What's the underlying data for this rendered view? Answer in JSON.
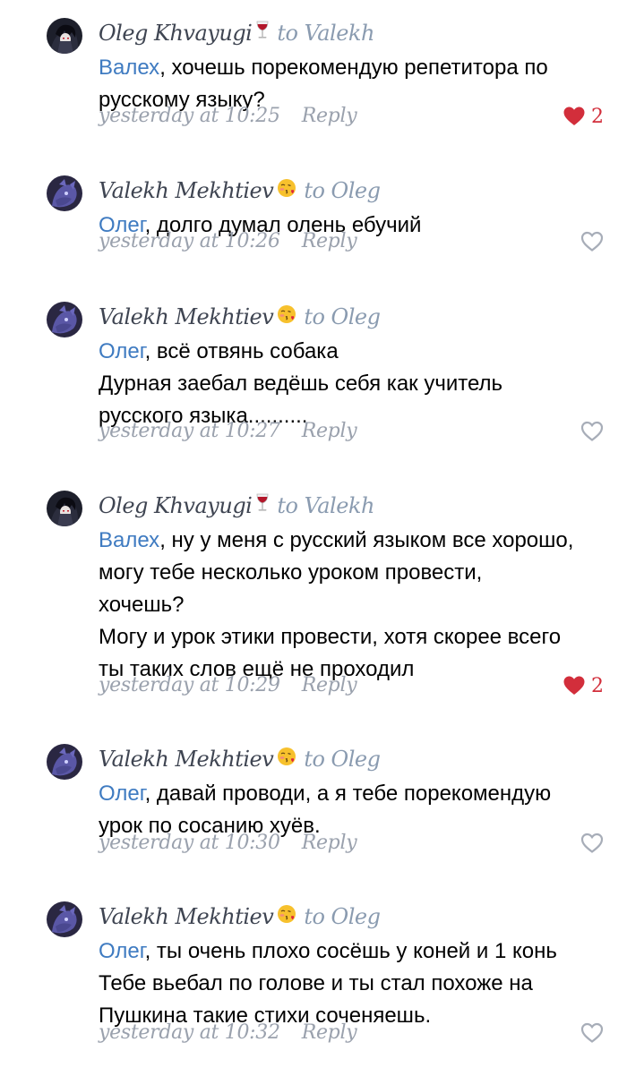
{
  "comments": [
    {
      "author": "Oleg Khvayugi",
      "author_emoji": "wine-glass-icon",
      "to": "to Valekh",
      "mention": "Валех",
      "lines": [
        ", хочешь порекомендую репетитора по",
        "русскому языку?"
      ],
      "time": "yesterday at 10:25",
      "reply": "Reply",
      "liked": true,
      "likes": "2"
    },
    {
      "author": "Valekh Mekhtiev",
      "author_emoji": "kissing-face-icon",
      "to": "to Oleg",
      "mention": "Олег",
      "lines": [
        ",  долго думал олень ебучий"
      ],
      "time": "yesterday at 10:26",
      "reply": "Reply",
      "liked": false,
      "likes": ""
    },
    {
      "author": "Valekh Mekhtiev",
      "author_emoji": "kissing-face-icon",
      "to": "to Oleg",
      "mention": "Олег",
      "lines": [
        ", всё отвянь собака",
        "Дурная заебал ведёшь себя как учитель",
        "русского языка.........."
      ],
      "time": "yesterday at 10:27",
      "reply": "Reply",
      "liked": false,
      "likes": ""
    },
    {
      "author": "Oleg Khvayugi",
      "author_emoji": "wine-glass-icon",
      "to": "to Valekh",
      "mention": "Валех",
      "lines": [
        ", ну у меня с русский языком все хорошо,",
        "могу тебе несколько уроком провести,",
        "хочешь?",
        "Могу и урок этики провести, хотя скорее всего",
        "ты таких слов ещё не проходил"
      ],
      "time": "yesterday at 10:29",
      "reply": "Reply",
      "liked": true,
      "likes": "2"
    },
    {
      "author": "Valekh Mekhtiev",
      "author_emoji": "kissing-face-icon",
      "to": "to Oleg",
      "mention": "Олег",
      "lines": [
        ", давай проводи,  а я тебе порекомендую",
        "урок по сосанию хуёв."
      ],
      "time": "yesterday at 10:30",
      "reply": "Reply",
      "liked": false,
      "likes": ""
    },
    {
      "author": "Valekh Mekhtiev",
      "author_emoji": "kissing-face-icon",
      "to": "to Oleg",
      "mention": "Олег",
      "lines": [
        ",  ты очень плохо сосёшь у коней и 1 конь",
        "Тебе вьебал по голове и ты стал похоже на",
        "Пушкина такие стихи соченяешь."
      ],
      "time": "yesterday at 10:32",
      "reply": "Reply",
      "liked": false,
      "likes": ""
    }
  ],
  "colors": {
    "mention": "#3f7bc1",
    "meta": "#9aa1ad",
    "to": "#8a9bb0",
    "heart_liked": "#d22e3b",
    "heart_empty": "#a7adb8"
  }
}
